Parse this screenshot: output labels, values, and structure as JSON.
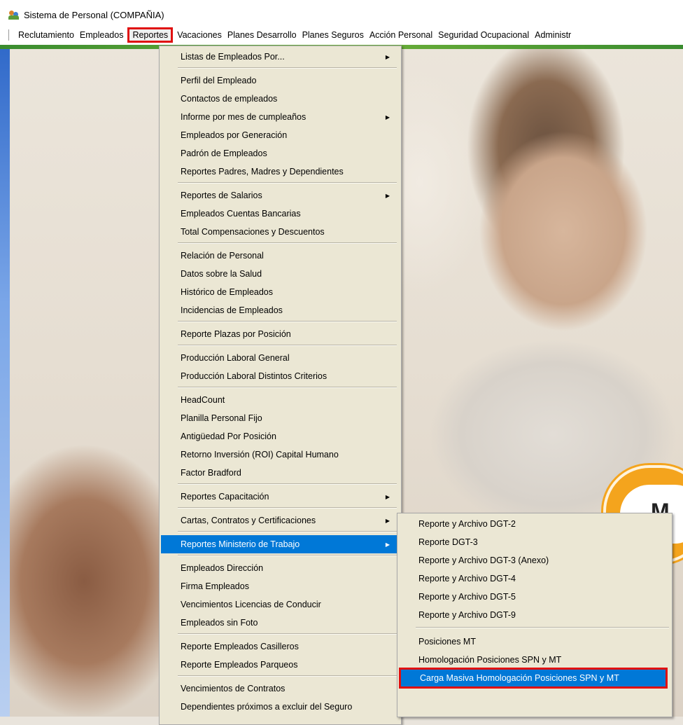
{
  "window": {
    "title": "Sistema de Personal (COMPAÑIA)"
  },
  "menubar": {
    "items": [
      "Reclutamiento",
      "Empleados",
      "Reportes",
      "Vacaciones",
      "Planes Desarrollo",
      "Planes Seguros",
      "Acción Personal",
      "Seguridad Ocupacional",
      "Administr"
    ],
    "active_item": "Reportes"
  },
  "reportes_menu": {
    "items": [
      "Listas de Empleados Por...",
      "Perfil del Empleado",
      "Contactos de empleados",
      "Informe por mes de cumpleaños",
      "Empleados por Generación",
      "Padrón de Empleados",
      "Reportes Padres, Madres y Dependientes",
      "Reportes de Salarios",
      "Empleados Cuentas Bancarias",
      "Total Compensaciones y Descuentos",
      "Relación de Personal",
      "Datos sobre la Salud",
      "Histórico de Empleados",
      "Incidencias de Empleados",
      "Reporte Plazas por Posición",
      "Producción Laboral General",
      "Producción Laboral Distintos Criterios",
      "HeadCount",
      "Planilla Personal Fijo",
      "Antigüedad Por Posición",
      "Retorno Inversión (ROI) Capital Humano",
      "Factor Bradford",
      "Reportes Capacitación",
      "Cartas, Contratos y Certificaciones",
      "Reportes Ministerio de Trabajo",
      "Empleados Dirección",
      "Firma Empleados",
      "Vencimientos Licencias de Conducir",
      "Empleados sin Foto",
      "Reporte Empleados Casilleros",
      "Reporte Empleados Parqueos",
      "Vencimientos de Contratos",
      "Dependientes próximos a excluir del Seguro"
    ],
    "highlighted": "Reportes Ministerio de Trabajo"
  },
  "ministerio_submenu": {
    "items": [
      "Reporte y Archivo DGT-2",
      "Reporte DGT-3",
      "Reporte y Archivo DGT-3 (Anexo)",
      "Reporte y Archivo DGT-4",
      "Reporte y Archivo DGT-5",
      "Reporte y Archivo DGT-9",
      "Posiciones MT",
      "Homologación Posiciones SPN y MT",
      "Carga Masiva Homologación Posiciones SPN y MT"
    ],
    "highlighted": "Carga Masiva Homologación Posiciones SPN y MT"
  },
  "background_badge": {
    "letter": "M"
  },
  "icons": {
    "app": "people-app-icon",
    "submenu_arrow": "triangle-right-icon"
  },
  "colors": {
    "menu_bg": "#ebe7d4",
    "highlight": "#0078d7",
    "annotation_red": "#e01010",
    "badge_orange": "#f4a41d"
  }
}
